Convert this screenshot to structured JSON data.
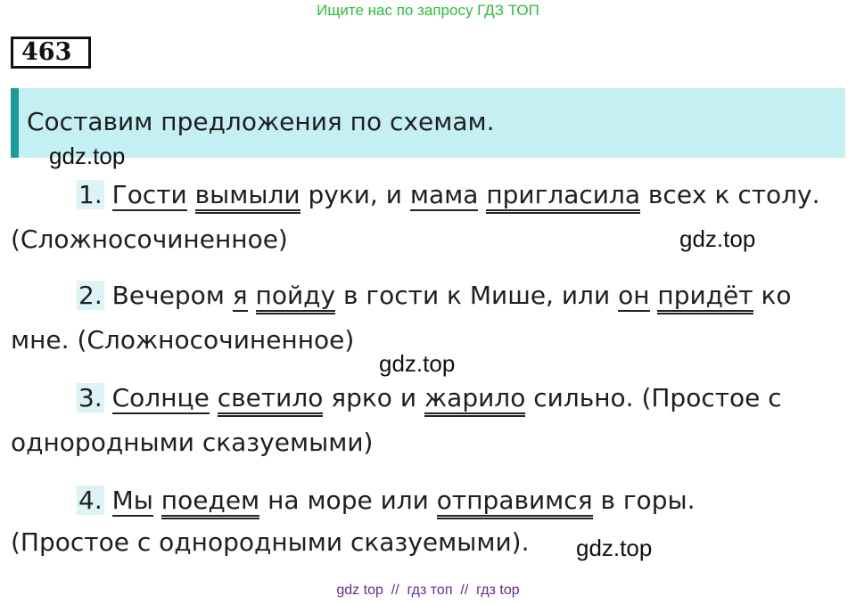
{
  "top_banner": "Ищите нас по запросу ГДЗ ТОП",
  "task_number": "463",
  "task_title": "Составим предложения по схемам.",
  "watermark": "gdz.top",
  "footer": "gdz top  //  гдз топ  //  гдз top",
  "s1": {
    "num": "1.",
    "w1": "Гости",
    "w2": "вымыли",
    "t1": " руки, и ",
    "w3": "мама",
    "w4": "пригласила",
    "t2": " всех к столу.",
    "type": "(Сложносочиненное)"
  },
  "s2": {
    "num": "2.",
    "t0": " Вечером ",
    "w1": "я",
    "w2": "пойду",
    "t1": " в гости к Мише, или ",
    "w3": "он",
    "w4": "придёт",
    "t2": " ко",
    "l2": "мне. (Сложносочиненное)"
  },
  "s3": {
    "num": "3.",
    "w1": "Солнце",
    "w2": "светило",
    "t1": " ярко и ",
    "w3": "жарило",
    "t2": " сильно. (Простое с",
    "l2": "однородными сказуемыми)"
  },
  "s4": {
    "num": "4.",
    "w1": "Мы",
    "w2": "поедем",
    "t1": " на море или ",
    "w3": "отправимся",
    "t2": " в горы.",
    "l2": "(Простое с однородными сказуемыми)."
  }
}
